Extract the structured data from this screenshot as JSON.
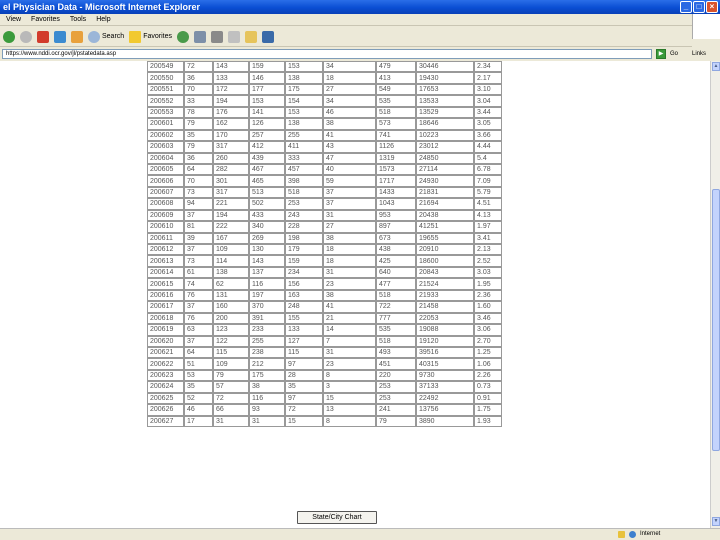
{
  "window": {
    "title": "el Physician Data - Microsoft Internet Explorer"
  },
  "menu": {
    "items": [
      "View",
      "Favorites",
      "Tools",
      "Help"
    ]
  },
  "toolbar": {
    "search_label": "Search",
    "favorites_label": "Favorites"
  },
  "address": {
    "url": "https://www.nddi.ocr.gov/jl/pstatedata.asp",
    "go_label": "Go",
    "links_label": "Links"
  },
  "table": {
    "rows": [
      [
        "200549",
        "72",
        "143",
        "159",
        "153",
        "34",
        "479",
        "30446",
        "2.34"
      ],
      [
        "200550",
        "36",
        "133",
        "146",
        "138",
        "18",
        "413",
        "19430",
        "2.17"
      ],
      [
        "200551",
        "70",
        "172",
        "177",
        "175",
        "27",
        "549",
        "17653",
        "3.10"
      ],
      [
        "200552",
        "33",
        "194",
        "153",
        "154",
        "34",
        "535",
        "13533",
        "3.04"
      ],
      [
        "200553",
        "78",
        "176",
        "141",
        "153",
        "46",
        "518",
        "13529",
        "3.44"
      ],
      [
        "200601",
        "79",
        "162",
        "126",
        "138",
        "38",
        "573",
        "18646",
        "3.05"
      ],
      [
        "200602",
        "35",
        "170",
        "257",
        "255",
        "41",
        "741",
        "10223",
        "3.66"
      ],
      [
        "200603",
        "79",
        "317",
        "412",
        "411",
        "43",
        "1126",
        "23012",
        "4.44"
      ],
      [
        "200604",
        "36",
        "260",
        "439",
        "333",
        "47",
        "1319",
        "24850",
        "5.4"
      ],
      [
        "200605",
        "64",
        "282",
        "467",
        "457",
        "40",
        "1573",
        "27114",
        "6.78"
      ],
      [
        "200606",
        "70",
        "301",
        "465",
        "398",
        "59",
        "1717",
        "24930",
        "7.09"
      ],
      [
        "200607",
        "73",
        "317",
        "513",
        "518",
        "37",
        "1433",
        "21831",
        "5.79"
      ],
      [
        "200608",
        "94",
        "221",
        "502",
        "253",
        "37",
        "1043",
        "21694",
        "4.51"
      ],
      [
        "200609",
        "37",
        "194",
        "433",
        "243",
        "31",
        "953",
        "20438",
        "4.13"
      ],
      [
        "200610",
        "81",
        "222",
        "340",
        "228",
        "27",
        "897",
        "41251",
        "1.97"
      ],
      [
        "200611",
        "39",
        "167",
        "269",
        "198",
        "38",
        "673",
        "19655",
        "3.41"
      ],
      [
        "200612",
        "37",
        "109",
        "130",
        "179",
        "18",
        "438",
        "20910",
        "2.13"
      ],
      [
        "200613",
        "73",
        "114",
        "143",
        "159",
        "18",
        "425",
        "18600",
        "2.52"
      ],
      [
        "200614",
        "61",
        "138",
        "137",
        "234",
        "31",
        "640",
        "20843",
        "3.03"
      ],
      [
        "200615",
        "74",
        "62",
        "116",
        "156",
        "23",
        "477",
        "21524",
        "1.95"
      ],
      [
        "200616",
        "76",
        "131",
        "197",
        "163",
        "38",
        "518",
        "21933",
        "2.36"
      ],
      [
        "200617",
        "37",
        "160",
        "370",
        "248",
        "41",
        "722",
        "21458",
        "1.60"
      ],
      [
        "200618",
        "76",
        "200",
        "391",
        "155",
        "21",
        "777",
        "22053",
        "3.46"
      ],
      [
        "200619",
        "63",
        "123",
        "233",
        "133",
        "14",
        "535",
        "19088",
        "3.06"
      ],
      [
        "200620",
        "37",
        "122",
        "255",
        "127",
        "7",
        "518",
        "19120",
        "2.70"
      ],
      [
        "200621",
        "64",
        "115",
        "238",
        "115",
        "31",
        "493",
        "39516",
        "1.25"
      ],
      [
        "200622",
        "51",
        "109",
        "212",
        "97",
        "23",
        "451",
        "40315",
        "1.06"
      ],
      [
        "200623",
        "53",
        "79",
        "175",
        "28",
        "8",
        "220",
        "9730",
        "2.26"
      ],
      [
        "200624",
        "35",
        "57",
        "38",
        "35",
        "3",
        "253",
        "37133",
        "0.73"
      ],
      [
        "200625",
        "52",
        "72",
        "116",
        "97",
        "15",
        "253",
        "22492",
        "0.91"
      ],
      [
        "200626",
        "46",
        "66",
        "93",
        "72",
        "13",
        "241",
        "13756",
        "1.75"
      ],
      [
        "200627",
        "17",
        "31",
        "31",
        "15",
        "8",
        "79",
        "3890",
        "1.93"
      ]
    ]
  },
  "chart_button": {
    "label": "State/City Chart"
  },
  "status": {
    "zone_label": "Internet"
  }
}
